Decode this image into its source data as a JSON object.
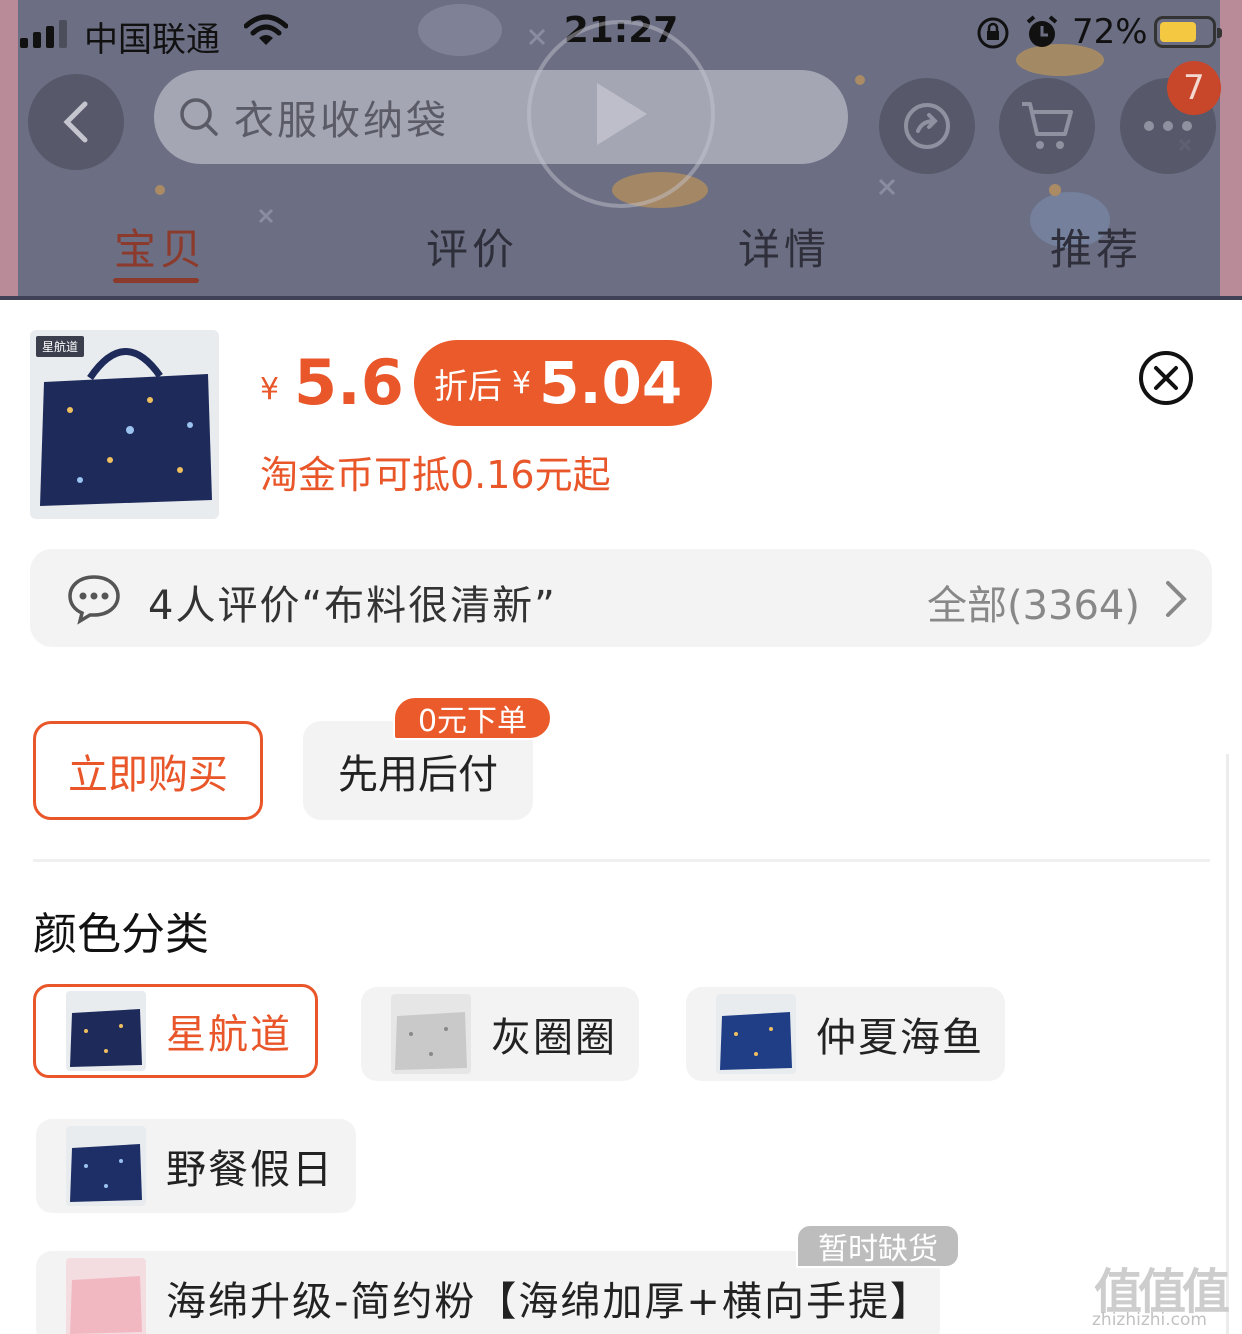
{
  "status_bar": {
    "carrier": "中国联通",
    "time": "21:27",
    "battery_percent": "72%",
    "battery_level": 0.72
  },
  "nav": {
    "search_placeholder": "衣服收纳袋",
    "cart_badge": "7",
    "tabs": [
      {
        "label": "宝贝",
        "active": true
      },
      {
        "label": "评价",
        "active": false
      },
      {
        "label": "详情",
        "active": false
      },
      {
        "label": "推荐",
        "active": false
      }
    ]
  },
  "product": {
    "thumbnail_tag": "星航道",
    "currency": "¥",
    "price": "5.6",
    "after_discount_label": "折后",
    "after_discount_price": "5.04",
    "coin_note": "淘金币可抵0.16元起"
  },
  "review": {
    "summary": "4人评价“布料很清新”",
    "all": "全部(3364)"
  },
  "actions": {
    "buy_now": "立即购买",
    "pay_later": "先用后付",
    "pay_later_tag": "0元下单"
  },
  "options": {
    "title": "颜色分类",
    "items": [
      {
        "label": "星航道",
        "selected": true
      },
      {
        "label": "灰圈圈",
        "selected": false
      },
      {
        "label": "仲夏海鱼",
        "selected": false
      },
      {
        "label": "野餐假日",
        "selected": false
      },
      {
        "label": "海绵升级-简约粉【海绵加厚+横向手提】",
        "selected": false,
        "tag": "暂时缺货"
      }
    ]
  },
  "watermark": {
    "brand": "值值值",
    "site": "zhizhizhi.com"
  },
  "colors": {
    "accent": "#e8562a",
    "accent_fill": "#ea5a2a",
    "option_bg": "#f3f3f3",
    "banner_bg": "#6c6f84"
  }
}
